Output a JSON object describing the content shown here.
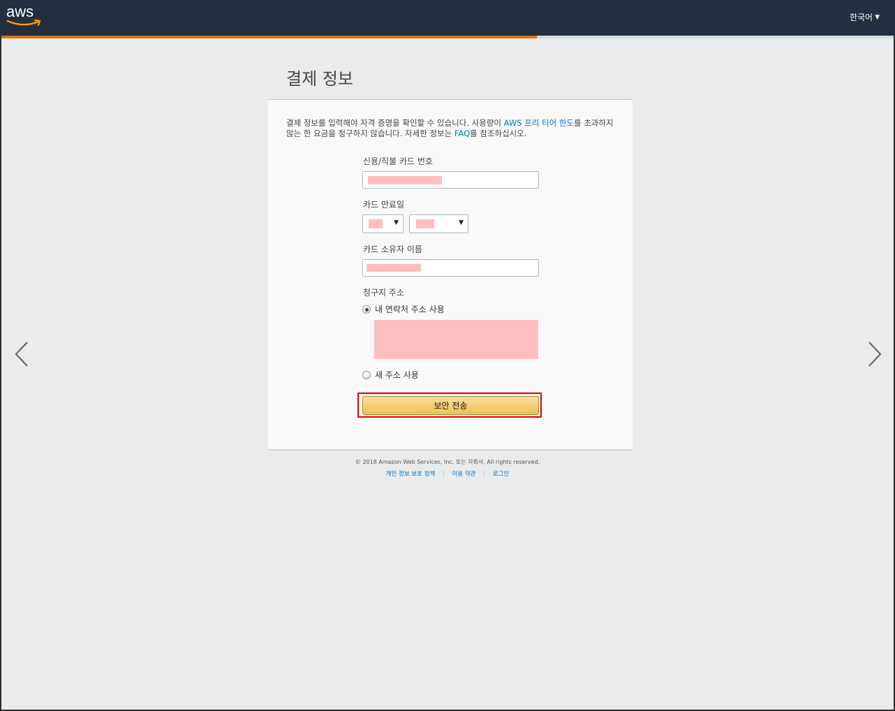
{
  "header": {
    "logo_text": "aws",
    "language": "한국어"
  },
  "progress": {
    "fraction": 0.6
  },
  "page": {
    "title": "결제 정보",
    "intro_1": "결제 정보를 입력해야 자격 증명을 확인할 수 있습니다. 사용량이 ",
    "intro_link_1": "AWS 프리 티어 한도",
    "intro_2": "를 초과하지 않는 한 요금을 청구하지 않습니다. 자세한 정보는 ",
    "intro_link_2": "FAQ",
    "intro_3": "를 참조하십시오."
  },
  "form": {
    "card_number_label": "신용/직불 카드 번호",
    "expiry_label": "카드 만료일",
    "holder_label": "카드 소유자 이름",
    "billing_label": "청구지 주소",
    "use_my_address": "내 연락처 주소 사용",
    "use_new_address": "새 주소 사용",
    "submit": "보안 전송"
  },
  "footer": {
    "copyright": "© 2018 Amazon Web Services, Inc. 또는 자회사. All rights reserved.",
    "links": [
      "개인 정보 보호 정책",
      "이용 약관",
      "로그인"
    ]
  },
  "icons": {
    "prev": "chevron-left-icon",
    "next": "chevron-right-icon"
  }
}
